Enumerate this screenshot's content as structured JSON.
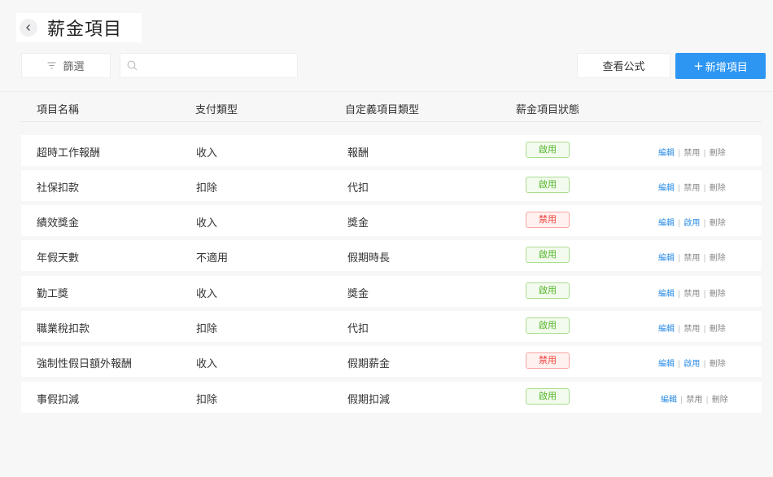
{
  "header": {
    "title": "薪金項目"
  },
  "toolbar": {
    "filter_label": "篩選",
    "search_placeholder": "",
    "formula_label": "查看公式",
    "add_label": "新增項目",
    "add_prefix": "+"
  },
  "table": {
    "columns": [
      "項目名稱",
      "支付類型",
      "自定義項目類型",
      "薪金項目狀態"
    ],
    "rows": [
      {
        "name": "超時工作報酬",
        "pay_type": "收入",
        "custom_type": "報酬",
        "status": "啟用",
        "status_on": true,
        "actions": [
          "編輯",
          "禁用",
          "刪除"
        ]
      },
      {
        "name": "社保扣款",
        "pay_type": "扣除",
        "custom_type": "代扣",
        "status": "啟用",
        "status_on": true,
        "actions": [
          "編輯",
          "禁用",
          "刪除"
        ]
      },
      {
        "name": "績效獎金",
        "pay_type": "收入",
        "custom_type": "獎金",
        "status": "禁用",
        "status_on": false,
        "actions": [
          "編輯",
          "啟用",
          "刪除"
        ]
      },
      {
        "name": "年假天數",
        "pay_type": "不適用",
        "custom_type": "假期時長",
        "status": "啟用",
        "status_on": true,
        "actions": [
          "編輯",
          "禁用",
          "刪除"
        ]
      },
      {
        "name": "勤工獎",
        "pay_type": "收入",
        "custom_type": "獎金",
        "status": "啟用",
        "status_on": true,
        "actions": [
          "編輯",
          "禁用",
          "刪除"
        ]
      },
      {
        "name": "職業稅扣款",
        "pay_type": "扣除",
        "custom_type": "代扣",
        "status": "啟用",
        "status_on": true,
        "actions": [
          "編輯",
          "禁用",
          "刪除"
        ]
      },
      {
        "name": "強制性假日額外報酬",
        "pay_type": "收入",
        "custom_type": "假期薪金",
        "status": "禁用",
        "status_on": false,
        "actions": [
          "編輯",
          "啟用",
          "刪除"
        ]
      },
      {
        "name": "事假扣減",
        "pay_type": "扣除",
        "custom_type": "假期扣減",
        "status": "啟用",
        "status_on": true,
        "actions": [
          "編輯",
          "禁用",
          "刪除"
        ]
      }
    ]
  },
  "colors": {
    "primary": "#2d96f3",
    "enabled_green": "#52b52a",
    "disabled_red": "#f0443c"
  }
}
